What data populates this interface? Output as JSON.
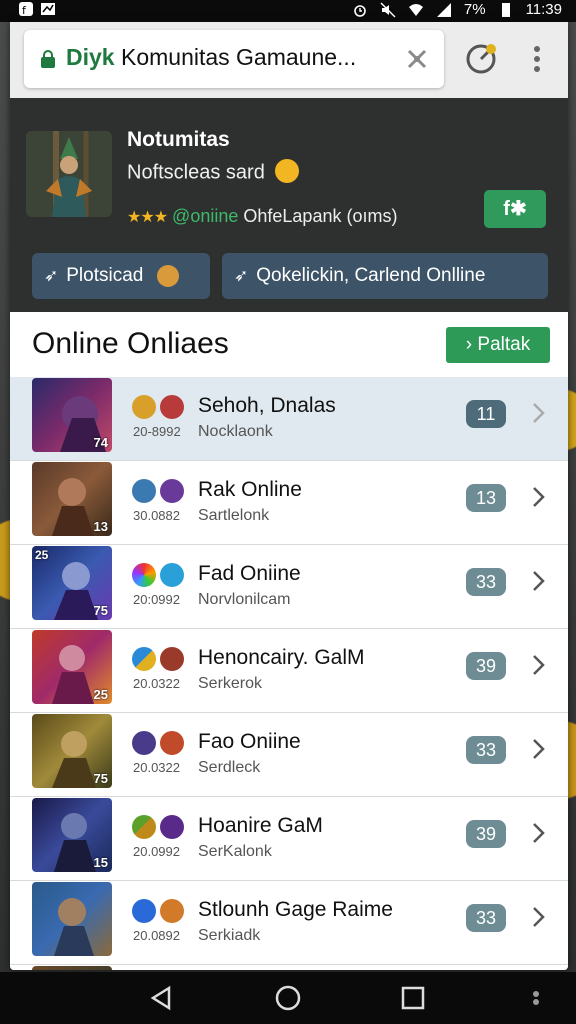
{
  "status_bar": {
    "time": "11:39",
    "battery": "7%"
  },
  "browser": {
    "url_domain": "Diyk",
    "url_rest": " Komunitas Gamaune..."
  },
  "game": {
    "title": "Notumitas",
    "subtitle": "Noftscleas sard",
    "rating_stars": "★★★",
    "online_label": "@oniine",
    "online_text": " OhfeLapank (oıms)",
    "share_label": "f✱",
    "action_a": "Plotsicad",
    "action_b": "Qokelickin, Carlend Onlline"
  },
  "section": {
    "title": "Online Onliaes",
    "action_label": "Paltak"
  },
  "rows": [
    {
      "name": "Sehoh, Dnalas",
      "sub": "Nocklaonk",
      "code": "20-8992",
      "count": "11",
      "thumb_num": "74",
      "thumb_badge": ""
    },
    {
      "name": "Rak Online",
      "sub": "Sartlelonk",
      "code": "30.0882",
      "count": "13",
      "thumb_num": "13",
      "thumb_badge": ""
    },
    {
      "name": "Fad Oniine",
      "sub": "Norvlonilcam",
      "code": "20:0992",
      "count": "33",
      "thumb_num": "75",
      "thumb_badge": "25"
    },
    {
      "name": "Henoncairy. GalM",
      "sub": "Serkerok",
      "code": "20.0322",
      "count": "39",
      "thumb_num": "25",
      "thumb_badge": ""
    },
    {
      "name": "Fao Oniine",
      "sub": "Serdleck",
      "code": "20.0322",
      "count": "33",
      "thumb_num": "75",
      "thumb_badge": ""
    },
    {
      "name": "Hoanire GaM",
      "sub": "SerKalonk",
      "code": "20.0992",
      "count": "39",
      "thumb_num": "15",
      "thumb_badge": ""
    },
    {
      "name": "Stlounh Gage Raime",
      "sub": "Serkiadk",
      "code": "20.0892",
      "count": "33",
      "thumb_num": "",
      "thumb_badge": ""
    }
  ],
  "colors": {
    "accent_green": "#2e9a58",
    "pill_blue": "#3d5468",
    "count_badge": "#4d6b79",
    "selected_row": "#dfe9ef"
  }
}
